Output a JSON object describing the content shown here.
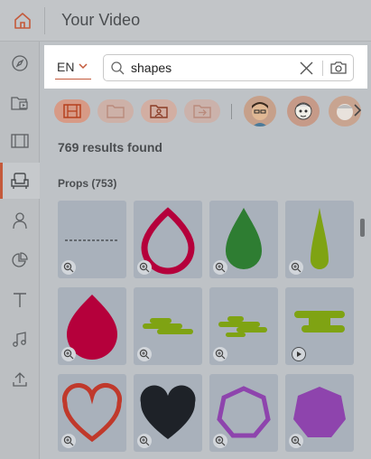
{
  "header": {
    "title": "Your Video"
  },
  "search": {
    "language": "EN",
    "query": "shapes"
  },
  "results": {
    "count_text": "769 results found"
  },
  "section": {
    "title": "Props (753)"
  },
  "colors": {
    "accent": "#c45a3b",
    "crimson": "#b5003b",
    "green": "#2e7d32",
    "olive": "#7fa313",
    "dark": "#1e2228",
    "purple": "#8e44ad"
  },
  "grid": [
    {
      "name": "dashed-line-prop"
    },
    {
      "name": "crimson-drop-outline-prop"
    },
    {
      "name": "green-drop-prop"
    },
    {
      "name": "olive-spike-prop"
    },
    {
      "name": "crimson-drop-prop"
    },
    {
      "name": "green-cloud-prop"
    },
    {
      "name": "green-cloud-prop-2"
    },
    {
      "name": "green-cloud-animated-prop"
    },
    {
      "name": "red-heart-outline-prop"
    },
    {
      "name": "black-heart-prop"
    },
    {
      "name": "purple-heptagon-outline-prop"
    },
    {
      "name": "purple-heptagon-prop"
    }
  ]
}
